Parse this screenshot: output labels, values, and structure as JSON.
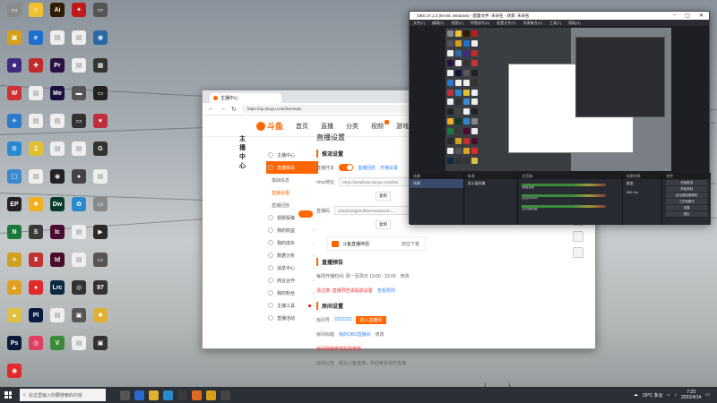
{
  "desktop_icons": [
    {
      "label": "",
      "color": "#8a8a8a",
      "glyph": "▭"
    },
    {
      "label": "",
      "color": "#f0c030",
      "glyph": "☺"
    },
    {
      "label": "Ai",
      "color": "#2d1a00",
      "glyph": "Ai"
    },
    {
      "label": "",
      "color": "#c01a1a",
      "glyph": "✦"
    },
    {
      "label": "",
      "color": "#555",
      "glyph": "▭"
    },
    {
      "label": "",
      "color": "#d8a018",
      "glyph": "▣"
    },
    {
      "label": "",
      "color": "#1f6fcf",
      "glyph": "e"
    },
    {
      "label": "",
      "color": "#eee",
      "glyph": "▤"
    },
    {
      "label": "",
      "color": "#eee",
      "glyph": "▤"
    },
    {
      "label": "",
      "color": "#2a6aa8",
      "glyph": "◉"
    },
    {
      "label": "",
      "color": "#402a80",
      "glyph": "☻"
    },
    {
      "label": "",
      "color": "#c02a2a",
      "glyph": "✚"
    },
    {
      "label": "Pr",
      "color": "#2a1040",
      "glyph": "Pr"
    },
    {
      "label": "",
      "color": "#eee",
      "glyph": "▤"
    },
    {
      "label": "",
      "color": "#333",
      "glyph": "▦"
    },
    {
      "label": "",
      "color": "#d03030",
      "glyph": "W"
    },
    {
      "label": "",
      "color": "#eee",
      "glyph": "▤"
    },
    {
      "label": "Me",
      "color": "#1a1040",
      "glyph": "Me"
    },
    {
      "label": "",
      "color": "#555",
      "glyph": "▬"
    },
    {
      "label": "",
      "color": "#222",
      "glyph": "▭"
    },
    {
      "label": "",
      "color": "#2a7ad0",
      "glyph": "✈"
    },
    {
      "label": "",
      "color": "#eee",
      "glyph": "▤"
    },
    {
      "label": "",
      "color": "#eee",
      "glyph": "▤"
    },
    {
      "label": "",
      "color": "#333",
      "glyph": "▭"
    },
    {
      "label": "",
      "color": "#c0303a",
      "glyph": "♥"
    },
    {
      "label": "",
      "color": "#2a8ad0",
      "glyph": "⚙"
    },
    {
      "label": "",
      "color": "#e0c030",
      "glyph": "Z"
    },
    {
      "label": "",
      "color": "#eee",
      "glyph": "▤"
    },
    {
      "label": "",
      "color": "#eee",
      "glyph": "▤"
    },
    {
      "label": "",
      "color": "#333",
      "glyph": "G"
    },
    {
      "label": "",
      "color": "#3a8ad0",
      "glyph": "▢"
    },
    {
      "label": "",
      "color": "#eee",
      "glyph": "▤"
    },
    {
      "label": "",
      "color": "#222",
      "glyph": "◉"
    },
    {
      "label": "",
      "color": "#444",
      "glyph": "●"
    },
    {
      "label": "",
      "color": "#eee",
      "glyph": "▤"
    },
    {
      "label": "",
      "color": "#222",
      "glyph": "EP"
    },
    {
      "label": "",
      "color": "#f0b020",
      "glyph": "✹"
    },
    {
      "label": "Dw",
      "color": "#0a3a2a",
      "glyph": "Dw"
    },
    {
      "label": "",
      "color": "#2a8ad0",
      "glyph": "✿"
    },
    {
      "label": "",
      "color": "#888",
      "glyph": "▭"
    },
    {
      "label": "",
      "color": "#1a7a3a",
      "glyph": "N"
    },
    {
      "label": "",
      "color": "#3a3a3a",
      "glyph": "S"
    },
    {
      "label": "Ic",
      "color": "#4a0a30",
      "glyph": "Ic"
    },
    {
      "label": "",
      "color": "#eee",
      "glyph": "▤"
    },
    {
      "label": "",
      "color": "#2a2a2a",
      "glyph": "▶"
    },
    {
      "label": "",
      "color": "#d0a020",
      "glyph": "☀"
    },
    {
      "label": "",
      "color": "#c03030",
      "glyph": "♜"
    },
    {
      "label": "Id",
      "color": "#4a0a2a",
      "glyph": "Id"
    },
    {
      "label": "",
      "color": "#eee",
      "glyph": "▤"
    },
    {
      "label": "",
      "color": "#555",
      "glyph": "▭"
    },
    {
      "label": "",
      "color": "#e0a020",
      "glyph": "▲"
    },
    {
      "label": "",
      "color": "#e02a2a",
      "glyph": "●"
    },
    {
      "label": "Lrc",
      "color": "#0a2a40",
      "glyph": "Lrc"
    },
    {
      "label": "",
      "color": "#333",
      "glyph": "◎"
    },
    {
      "label": "",
      "color": "#333",
      "glyph": "97"
    },
    {
      "label": "",
      "color": "#e0c040",
      "glyph": "▲"
    },
    {
      "label": "Pl",
      "color": "#0a1a40",
      "glyph": "Pl"
    },
    {
      "label": "",
      "color": "#eee",
      "glyph": "▤"
    },
    {
      "label": "",
      "color": "#555",
      "glyph": "▣"
    },
    {
      "label": "",
      "color": "#e0b030",
      "glyph": "✹"
    },
    {
      "label": "Ps",
      "color": "#0a1a3a",
      "glyph": "Ps"
    },
    {
      "label": "",
      "color": "#e04060",
      "glyph": "◎"
    },
    {
      "label": "",
      "color": "#3a8a3a",
      "glyph": "V"
    },
    {
      "label": "",
      "color": "#eee",
      "glyph": "▤"
    },
    {
      "label": "",
      "color": "#333",
      "glyph": "▣"
    },
    {
      "label": "",
      "color": "#e02a2a",
      "glyph": "◉"
    }
  ],
  "browser": {
    "tab_title": "主播中心",
    "url": "https://sp.douyu.com/live/main",
    "nav": [
      "首页",
      "直播",
      "分类",
      "视频",
      "游戏"
    ],
    "logo_text": "斗鱼",
    "sidebar_title": "主播中心",
    "menu": [
      {
        "label": "主播中心",
        "type": "item",
        "active": false
      },
      {
        "label": "直播相关",
        "type": "item",
        "active": true
      },
      {
        "label": "基础信息",
        "type": "sub",
        "selected": false
      },
      {
        "label": "直播设置",
        "type": "sub",
        "selected": true
      },
      {
        "label": "直播回放",
        "type": "sub",
        "selected": false
      },
      {
        "label": "视频投稿",
        "type": "item",
        "active": false
      },
      {
        "label": "我的收益",
        "type": "item",
        "active": false
      },
      {
        "label": "我的成长",
        "type": "item",
        "active": false
      },
      {
        "label": "数据分析",
        "type": "item",
        "active": false
      },
      {
        "label": "消息中心",
        "type": "item",
        "active": false
      },
      {
        "label": "商业合作",
        "type": "item",
        "active": false
      },
      {
        "label": "我的粉丝",
        "type": "item",
        "active": false
      },
      {
        "label": "主播工具",
        "type": "item",
        "active": false,
        "dot": true
      },
      {
        "label": "直播活动",
        "type": "item",
        "active": false
      }
    ],
    "page_title": "直播设置",
    "push_section": "推流设置",
    "push_toggle_label": "直播开关",
    "push_links": [
      "直播回放",
      "开播设置"
    ],
    "rtmp_label": "rtmp地址",
    "rtmp_value": "rtmp://sendtc3a.douyu.com/live",
    "copy_label": "复制",
    "key_label": "直播码",
    "key_value": "2222222rjpmr9f2a?wsSecret=...",
    "copy_label2": "复制",
    "dl_title": "斗鱼直播伴侣",
    "dl_button": "前往下载",
    "notice_section": "直播预告",
    "notice_row1": "每周开播时间: 周一至周日 19:00 - 23:00",
    "notice_row1_btn": "修改",
    "notice_row2_red": "请注意: 直播预告需提前设置",
    "notice_row2_link": "查看规则",
    "room_section": "房间设置",
    "room_id_label": "房间号",
    "room_id_value": "2222222",
    "room_id_btn": "进入直播间",
    "room_name_label": "房间标题",
    "room_name_value": "我的OBS直播间",
    "room_name_btn": "修改",
    "room_warn": "房间标题修改后需审核",
    "room_notice_label": "房间公告",
    "room_notice_value": "我在斗鱼直播，欢迎来看我的直播"
  },
  "obs": {
    "title": "OBS 27.1.3 (64-bit, windows) - 配置文件: 未命名 - 场景: 未命名",
    "menu": [
      "文件(F)",
      "编辑(E)",
      "视图(V)",
      "停靠部件(D)",
      "配置文件(P)",
      "场景集合(S)",
      "工具(T)",
      "帮助(H)"
    ],
    "docks": {
      "scenes": {
        "title": "场景",
        "items": [
          "场景"
        ]
      },
      "sources": {
        "title": "来源",
        "items": [
          "显示器采集"
        ]
      },
      "mixer": {
        "title": "混音器",
        "items": [
          "桌面音频",
          "麦克风/Aux",
          "显示器采集"
        ]
      },
      "transitions": {
        "title": "场景转换",
        "fade": "渐变",
        "duration_label": "时长",
        "duration": "300 ms"
      },
      "controls": {
        "title": "控件",
        "buttons": [
          "开始推流",
          "开始录制",
          "启动虚拟摄像机",
          "工作室模式",
          "设置",
          "退出"
        ]
      }
    },
    "status": "LIVE: 00:00:00  REC: 00:00:00  CPU: 2.0%, 30.00 fps"
  },
  "taskbar": {
    "search_placeholder": "在这里输入你要搜索的内容",
    "weather": "29°C 多云",
    "time": "7:23",
    "date": "2022/4/14"
  }
}
